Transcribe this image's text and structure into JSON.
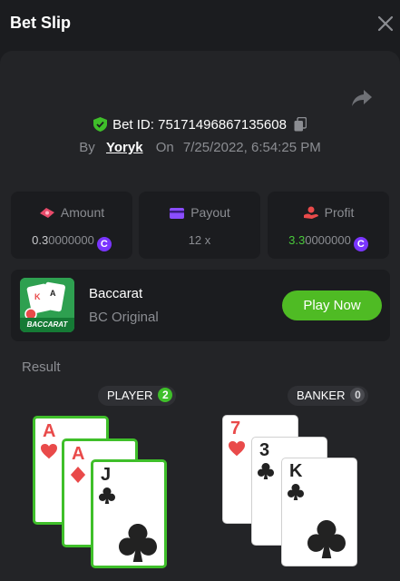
{
  "header": {
    "title": "Bet Slip"
  },
  "bet": {
    "id": "Bet ID: 75171496867135608",
    "by_label": "By",
    "user": "Yoryk",
    "on_label": "On",
    "datetime": "7/25/2022, 6:54:25 PM"
  },
  "stats": {
    "amount": {
      "label": "Amount",
      "value_main": "0.3",
      "value_dim": "0000000"
    },
    "payout": {
      "label": "Payout",
      "value": "12 x"
    },
    "profit": {
      "label": "Profit",
      "value_main": "3.3",
      "value_dim": "0000000"
    }
  },
  "game": {
    "name": "Baccarat",
    "subtitle": "BC Original",
    "thumb_text": "BACCARAT",
    "play_label": "Play Now"
  },
  "result": {
    "label": "Result",
    "player": {
      "label": "PLAYER",
      "count": "2"
    },
    "banker": {
      "label": "BANKER",
      "count": "0"
    },
    "player_cards": [
      {
        "rank": "A",
        "suit": "heart"
      },
      {
        "rank": "A",
        "suit": "diamond"
      },
      {
        "rank": "J",
        "suit": "club"
      }
    ],
    "banker_cards": [
      {
        "rank": "7",
        "suit": "heart"
      },
      {
        "rank": "3",
        "suit": "club"
      },
      {
        "rank": "K",
        "suit": "club"
      }
    ]
  },
  "colors": {
    "accent_green": "#4fbb24",
    "win_border": "#3fbf2a",
    "coin": "#7a35ff",
    "panel": "#232427"
  }
}
